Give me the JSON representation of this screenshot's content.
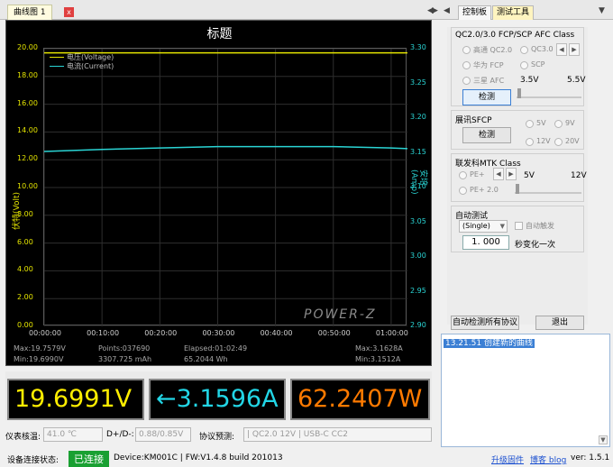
{
  "tabs": {
    "chart_tab": "曲线图 1",
    "close": "x"
  },
  "chart": {
    "title": "标题",
    "ylabel_left": "伏特(Volt)",
    "ylabel_right": "安培(Amp)",
    "legend": [
      "电压(Voltage)",
      "电流(Current)"
    ],
    "y_left_ticks": [
      "20.00",
      "18.00",
      "16.00",
      "14.00",
      "12.00",
      "10.00",
      "8.00",
      "6.00",
      "4.00",
      "2.00",
      "0.00"
    ],
    "y_right_ticks": [
      "3.30",
      "3.25",
      "3.20",
      "3.15",
      "3.10",
      "3.05",
      "3.00",
      "2.95",
      "2.90"
    ],
    "x_ticks": [
      "00:00:00",
      "00:10:00",
      "00:20:00",
      "00:30:00",
      "00:40:00",
      "00:50:00",
      "01:00:00"
    ],
    "stats": {
      "max_v": "Max:19.7579V",
      "min_v": "Min:19.6990V",
      "points": "Points:037690",
      "mah": "3307.725 mAh",
      "elapsed": "Elapsed:01:02:49",
      "wh": "65.2044 Wh",
      "max_a": "Max:3.1628A",
      "min_a": "Min:3.1512A"
    },
    "watermark": "POWER-Z",
    "colors": {
      "voltage": "#e4e400",
      "current": "#2ad4d4"
    }
  },
  "chart_data": {
    "type": "line",
    "title": "标题",
    "xlabel": "",
    "ylabel": "伏特(Volt)",
    "ylabel_right": "安培(Amp)",
    "x": [
      "00:00:00",
      "00:10:00",
      "00:20:00",
      "00:30:00",
      "00:40:00",
      "00:50:00",
      "01:00:00",
      "01:02:49"
    ],
    "ylim": [
      0,
      20
    ],
    "ylim_right": [
      2.9,
      3.3
    ],
    "series": [
      {
        "name": "电压(Voltage)",
        "axis": "left",
        "values": [
          19.7,
          19.7,
          19.7,
          19.7,
          19.7,
          19.7,
          19.7,
          19.7
        ]
      },
      {
        "name": "电流(Current)",
        "axis": "right",
        "values": [
          3.152,
          3.155,
          3.157,
          3.159,
          3.159,
          3.159,
          3.157,
          3.156
        ]
      }
    ]
  },
  "readouts": {
    "voltage": "19.6991V",
    "current": "←3.1596A",
    "power": "62.2407W",
    "colors": {
      "voltage": "#ffee00",
      "current": "#22d6e6",
      "power": "#ff7a00"
    }
  },
  "info": {
    "temp_label": "仪表核温:",
    "temp_value": "41.0 ℃",
    "dpdm_label": "D+/D-:",
    "dpdm_value": "0.88/0.85V",
    "protocol_label": "协议预测:",
    "protocol_value": "| QC2.0 12V | USB-C CC2"
  },
  "status": {
    "label": "设备连接状态:",
    "connected": "已连接",
    "device": "Device:KM001C | FW:V1.4.8 build 201013",
    "links": [
      "升级固件",
      "博客 blog"
    ],
    "version": "ver: 1.5.1"
  },
  "right_tabs": [
    "控制板",
    "测试工具"
  ],
  "qc_group": {
    "title": "QC2.0/3.0 FCP/SCP AFC Class",
    "options": [
      "高通 QC2.0",
      "QC3.0",
      "华为 FCP",
      "SCP",
      "三星 AFC"
    ],
    "range_min": "3.5V",
    "range_max": "5.5V",
    "detect": "检测"
  },
  "sfcp_group": {
    "title": "展讯SFCP",
    "detect": "检测",
    "options": [
      "5V",
      "9V",
      "12V",
      "20V"
    ]
  },
  "mtk_group": {
    "title": "联发科MTK Class",
    "options": [
      "PE+",
      "PE+ 2.0"
    ],
    "range_min": "5V",
    "range_max": "12V"
  },
  "auto_group": {
    "title": "自动测试",
    "mode": "(Single)",
    "auto_trigger": "自动触发",
    "interval_value": "1. 000",
    "interval_label": "秒变化一次"
  },
  "bottom_buttons": {
    "auto_detect": "自动检测所有协议",
    "exit": "退出"
  },
  "log": {
    "line": "13.21.51 创建新的曲线"
  }
}
